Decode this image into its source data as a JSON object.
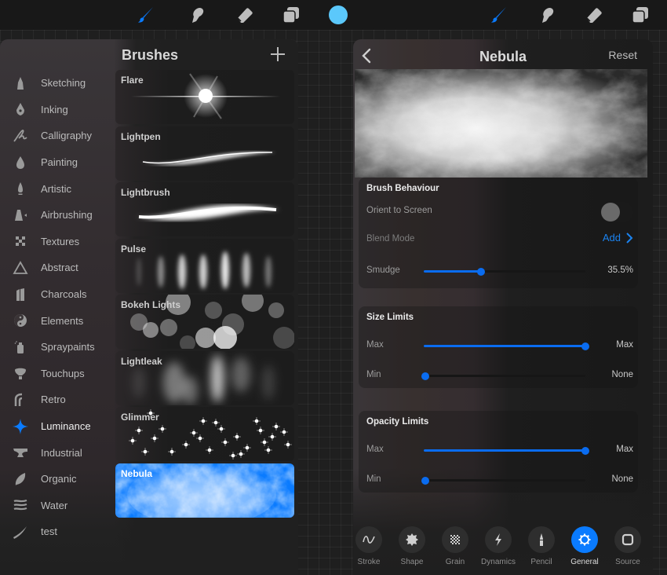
{
  "toolbar": {
    "tools": [
      {
        "name": "paint",
        "icon": "brush-icon",
        "active": true
      },
      {
        "name": "smudge",
        "icon": "smudge-finger-icon",
        "active": false
      },
      {
        "name": "erase",
        "icon": "eraser-icon",
        "active": false
      },
      {
        "name": "layers",
        "icon": "layers-icon",
        "active": false
      },
      {
        "name": "color",
        "icon": "color-swatch",
        "active": false
      }
    ],
    "accent_color": "#0a7bff",
    "current_color": "#5bc8fb"
  },
  "brush_library": {
    "title": "Brushes",
    "add_label": "+",
    "categories": [
      {
        "label": "Sketching",
        "icon": "sketching-icon"
      },
      {
        "label": "Inking",
        "icon": "inking-pen-nib-icon"
      },
      {
        "label": "Calligraphy",
        "icon": "calligraphy-icon"
      },
      {
        "label": "Painting",
        "icon": "paint-drop-icon"
      },
      {
        "label": "Artistic",
        "icon": "artistic-icon"
      },
      {
        "label": "Airbrushing",
        "icon": "airbrush-icon"
      },
      {
        "label": "Textures",
        "icon": "textures-checker-icon"
      },
      {
        "label": "Abstract",
        "icon": "abstract-triangle-icon"
      },
      {
        "label": "Charcoals",
        "icon": "charcoal-icon"
      },
      {
        "label": "Elements",
        "icon": "elements-yin-yang-icon"
      },
      {
        "label": "Spraypaints",
        "icon": "spraycan-icon"
      },
      {
        "label": "Touchups",
        "icon": "touchups-icon"
      },
      {
        "label": "Retro",
        "icon": "retro-icon"
      },
      {
        "label": "Luminance",
        "icon": "luminance-sparkle-icon",
        "active": true
      },
      {
        "label": "Industrial",
        "icon": "anvil-icon"
      },
      {
        "label": "Organic",
        "icon": "leaf-icon"
      },
      {
        "label": "Water",
        "icon": "water-waves-icon"
      },
      {
        "label": "test",
        "icon": "stroke-icon"
      }
    ],
    "brushes": [
      {
        "name": "Flare",
        "preview": "flare"
      },
      {
        "name": "Lightpen",
        "preview": "lightpen"
      },
      {
        "name": "Lightbrush",
        "preview": "lightbrush"
      },
      {
        "name": "Pulse",
        "preview": "pulse"
      },
      {
        "name": "Bokeh Lights",
        "preview": "bokeh"
      },
      {
        "name": "Lightleak",
        "preview": "lightleak"
      },
      {
        "name": "Glimmer",
        "preview": "glimmer"
      },
      {
        "name": "Nebula",
        "preview": "nebula",
        "selected": true
      }
    ]
  },
  "brush_studio": {
    "back_label": "<",
    "title": "Nebula",
    "reset_label": "Reset",
    "brush_behaviour": {
      "title": "Brush Behaviour",
      "orient_to_screen": {
        "label": "Orient to Screen",
        "on": false
      },
      "blend_mode": {
        "label": "Blend Mode",
        "value": "Add"
      },
      "smudge": {
        "label": "Smudge",
        "value_text": "35.5%",
        "value": 0.355
      }
    },
    "size_limits": {
      "title": "Size Limits",
      "max": {
        "label": "Max",
        "value_text": "Max",
        "value": 1.0
      },
      "min": {
        "label": "Min",
        "value_text": "None",
        "value": 0.0
      }
    },
    "opacity_limits": {
      "title": "Opacity Limits",
      "max": {
        "label": "Max",
        "value_text": "Max",
        "value": 1.0
      },
      "min": {
        "label": "Min",
        "value_text": "None",
        "value": 0.0
      }
    },
    "tabs": [
      {
        "label": "Stroke",
        "icon": "stroke-wave-icon"
      },
      {
        "label": "Shape",
        "icon": "shape-badge-icon"
      },
      {
        "label": "Grain",
        "icon": "grain-checker-icon"
      },
      {
        "label": "Dynamics",
        "icon": "dynamics-bolt-icon"
      },
      {
        "label": "Pencil",
        "icon": "pencil-tip-icon"
      },
      {
        "label": "General",
        "icon": "gear-icon",
        "active": true
      },
      {
        "label": "Source",
        "icon": "source-square-icon"
      }
    ]
  }
}
